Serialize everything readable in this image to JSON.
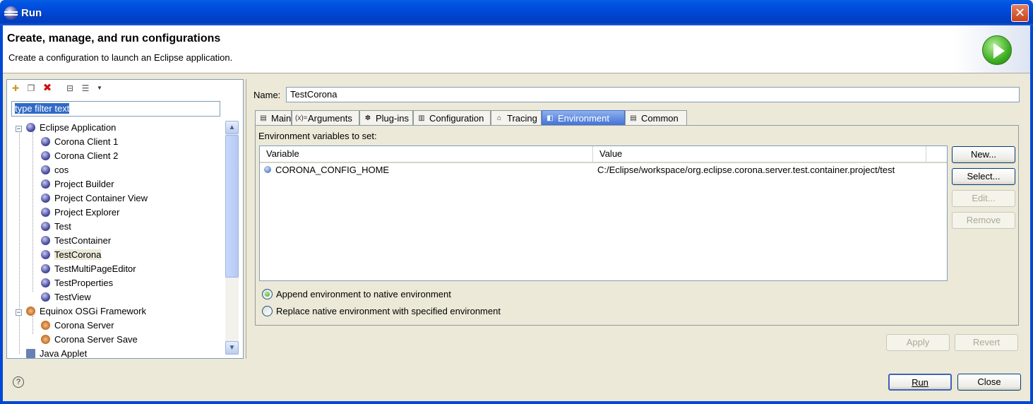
{
  "window": {
    "title": "Run"
  },
  "banner": {
    "title": "Create, manage, and run configurations",
    "subtitle": "Create a configuration to launch an Eclipse application."
  },
  "filter": {
    "placeholder": "type filter text"
  },
  "tree": {
    "groups": [
      {
        "label": "Eclipse Application",
        "items": [
          "Corona Client 1",
          "Corona Client 2",
          "cos",
          "Project Builder",
          "Project Container View",
          "Project Explorer",
          "Test",
          "TestContainer",
          "TestCorona",
          "TestMultiPageEditor",
          "TestProperties",
          "TestView"
        ]
      },
      {
        "label": "Equinox OSGi Framework",
        "items": [
          "Corona Server",
          "Corona Server Save"
        ]
      },
      {
        "label": "Java Applet",
        "items": []
      }
    ],
    "selected": "TestCorona"
  },
  "config": {
    "name_label": "Name:",
    "name_value": "TestCorona"
  },
  "tabs": [
    {
      "label": "Main"
    },
    {
      "label": "Arguments"
    },
    {
      "label": "Plug-ins"
    },
    {
      "label": "Configuration"
    },
    {
      "label": "Tracing"
    },
    {
      "label": "Environment",
      "active": true
    },
    {
      "label": "Common"
    }
  ],
  "env": {
    "section_label": "Environment variables to set:",
    "columns": [
      "Variable",
      "Value"
    ],
    "rows": [
      {
        "variable": "CORONA_CONFIG_HOME",
        "value": "C:/Eclipse/workspace/org.eclipse.corona.server.test.container.project/test"
      }
    ],
    "buttons": {
      "new": "New...",
      "select": "Select...",
      "edit": "Edit...",
      "remove": "Remove"
    },
    "append_label": "Append environment to native environment",
    "replace_label": "Replace native environment with specified environment",
    "mode": "append"
  },
  "actions": {
    "apply": "Apply",
    "revert": "Revert",
    "run": "Run",
    "close": "Close",
    "help": "?"
  }
}
